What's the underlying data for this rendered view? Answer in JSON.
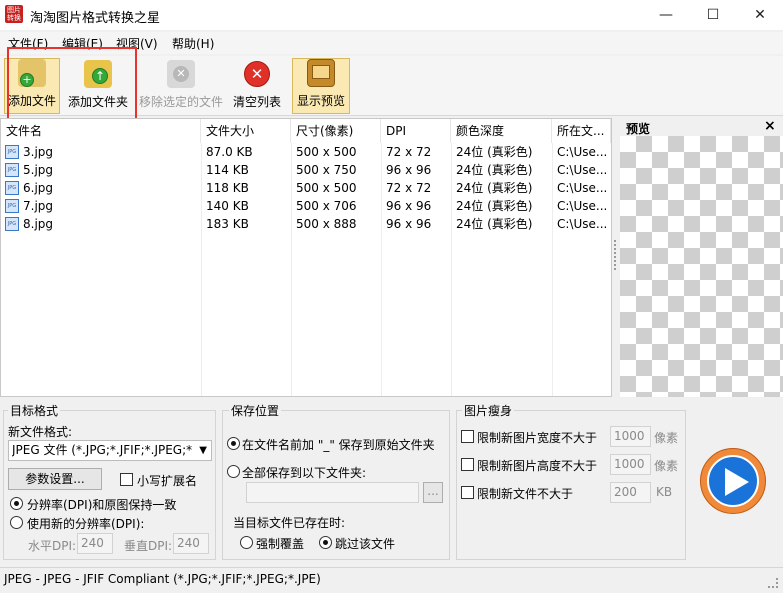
{
  "window": {
    "logo_text": "图片转换",
    "title": "淘淘图片格式转换之星",
    "min_icon": "—",
    "max_icon": "☐",
    "close_icon": "✕"
  },
  "menu": [
    {
      "label": "文件(F)"
    },
    {
      "label": "编辑(E)"
    },
    {
      "label": "视图(V)"
    },
    {
      "label": "帮助(H)"
    }
  ],
  "toolbar": {
    "add_file": "添加文件",
    "add_folder": "添加文件夹",
    "remove_selected": "移除选定的文件",
    "clear_list": "清空列表",
    "show_preview": "显示预览"
  },
  "filelist": {
    "columns": [
      "文件名",
      "文件大小",
      "尺寸(像素)",
      "DPI",
      "颜色深度",
      "所在文..."
    ],
    "rows": [
      {
        "name": "3.jpg",
        "size": "87.0 KB",
        "dims": "500 x 500",
        "dpi": "72 x 72",
        "depth": "24位 (真彩色)",
        "loc": "C:\\Use..."
      },
      {
        "name": "5.jpg",
        "size": "114 KB",
        "dims": "500 x 750",
        "dpi": "96 x 96",
        "depth": "24位 (真彩色)",
        "loc": "C:\\Use..."
      },
      {
        "name": "6.jpg",
        "size": "118 KB",
        "dims": "500 x 500",
        "dpi": "72 x 72",
        "depth": "24位 (真彩色)",
        "loc": "C:\\Use..."
      },
      {
        "name": "7.jpg",
        "size": "140 KB",
        "dims": "500 x 706",
        "dpi": "96 x 96",
        "depth": "24位 (真彩色)",
        "loc": "C:\\Use..."
      },
      {
        "name": "8.jpg",
        "size": "183 KB",
        "dims": "500 x 888",
        "dpi": "96 x 96",
        "depth": "24位 (真彩色)",
        "loc": "C:\\Use..."
      }
    ],
    "file_icon_text": "JPG"
  },
  "preview": {
    "title": "预览",
    "close": "×"
  },
  "target_format": {
    "group_title": "目标格式",
    "new_format_label": "新文件格式:",
    "format_value": "JPEG 文件 (*.JPG;*.JFIF;*.JPEG;*",
    "params_button": "参数设置...",
    "lowercase_ext": "小写扩展名",
    "keep_dpi": "分辨率(DPI)和原图保持一致",
    "use_new_dpi": "使用新的分辨率(DPI):",
    "h_dpi_label": "水平DPI:",
    "h_dpi_value": "240",
    "v_dpi_label": "垂直DPI:",
    "v_dpi_value": "240"
  },
  "save_location": {
    "group_title": "保存位置",
    "prefix_option": "在文件名前加 \"_\" 保存到原始文件夹",
    "folder_option": "全部保存到以下文件夹:",
    "folder_value": "",
    "browse": "...",
    "exists_label": "当目标文件已存在时:",
    "overwrite": "强制覆盖",
    "skip": "跳过该文件"
  },
  "slim": {
    "group_title": "图片瘦身",
    "limit_width": "限制新图片宽度不大于",
    "width_value": "1000",
    "width_unit": "像素",
    "limit_height": "限制新图片高度不大于",
    "height_value": "1000",
    "height_unit": "像素",
    "limit_size": "限制新文件不大于",
    "size_value": "200",
    "size_unit": "KB"
  },
  "status": {
    "text": "JPEG - JPEG - JFIF Compliant (*.JPG;*.JFIF;*.JPEG;*.JPE)"
  },
  "colors": {
    "accent_red": "#e8322c",
    "toolbar_active": "#fbe9b4",
    "start_button": "#1a73d9"
  }
}
